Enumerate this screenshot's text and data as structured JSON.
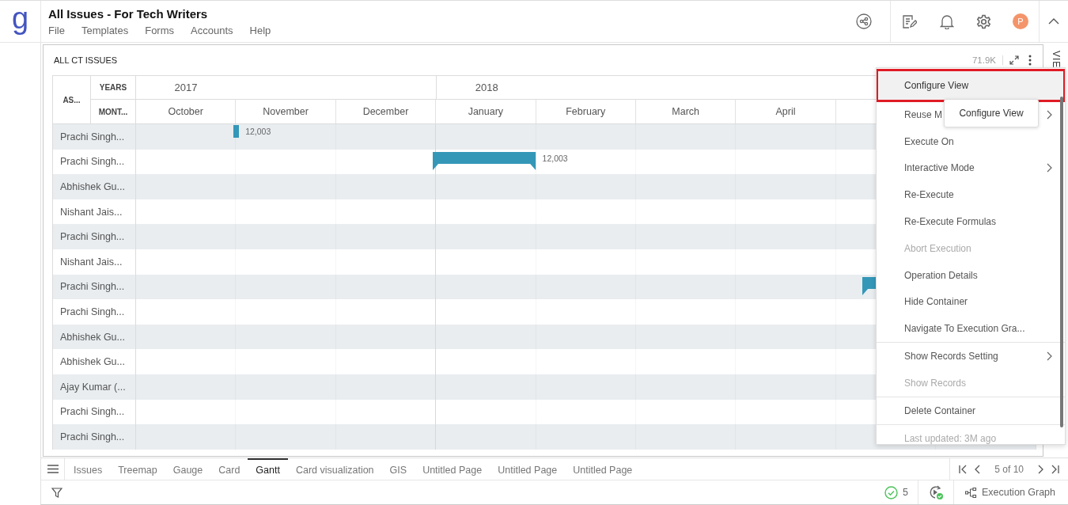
{
  "logo": "g",
  "header": {
    "title": "All Issues - For Tech Writers",
    "menu": [
      "File",
      "Templates",
      "Forms",
      "Accounts",
      "Help"
    ],
    "avatar": "P"
  },
  "side_strip": {
    "label": "VIE"
  },
  "panel": {
    "title": "ALL CT ISSUES",
    "count": "71.9K"
  },
  "gantt": {
    "corner": "AS...",
    "years_label": "YEARS",
    "months_label": "MONT...",
    "years": [
      {
        "label": "2017",
        "months": [
          "October",
          "November",
          "December"
        ]
      },
      {
        "label": "2018",
        "months": [
          "January",
          "February",
          "March",
          "April"
        ]
      }
    ],
    "rows": [
      {
        "name": "Prachi Singh...",
        "bar_label": "12,003"
      },
      {
        "name": "Prachi Singh...",
        "bar_label": "12,003"
      },
      {
        "name": "Abhishek Gu..."
      },
      {
        "name": "Nishant Jais..."
      },
      {
        "name": "Prachi Singh..."
      },
      {
        "name": "Nishant Jais..."
      },
      {
        "name": "Prachi Singh..."
      },
      {
        "name": "Prachi Singh..."
      },
      {
        "name": "Abhishek Gu..."
      },
      {
        "name": "Abhishek Gu..."
      },
      {
        "name": "Ajay Kumar (..."
      },
      {
        "name": "Prachi Singh..."
      },
      {
        "name": "Prachi Singh..."
      }
    ]
  },
  "menu": {
    "groups": [
      [
        {
          "label": "Configure View",
          "selected": true,
          "outlined": true,
          "disabled": false,
          "submenu": false
        },
        {
          "label": "Reuse M",
          "selected": false,
          "outlined": false,
          "disabled": false,
          "submenu": true
        },
        {
          "label": "Execute On",
          "selected": false,
          "outlined": false,
          "disabled": false,
          "submenu": false
        },
        {
          "label": "Interactive Mode",
          "selected": false,
          "outlined": false,
          "disabled": false,
          "submenu": true
        },
        {
          "label": "Re-Execute",
          "selected": false,
          "outlined": false,
          "disabled": false,
          "submenu": false
        },
        {
          "label": "Re-Execute Formulas",
          "selected": false,
          "outlined": false,
          "disabled": false,
          "submenu": false
        },
        {
          "label": "Abort Execution",
          "selected": false,
          "outlined": false,
          "disabled": true,
          "submenu": false
        },
        {
          "label": "Operation Details",
          "selected": false,
          "outlined": false,
          "disabled": false,
          "submenu": false
        },
        {
          "label": "Hide Container",
          "selected": false,
          "outlined": false,
          "disabled": false,
          "submenu": false
        },
        {
          "label": "Navigate To Execution Gra...",
          "selected": false,
          "outlined": false,
          "disabled": false,
          "submenu": false
        }
      ],
      [
        {
          "label": "Show Records Setting",
          "selected": false,
          "outlined": false,
          "disabled": false,
          "submenu": true
        },
        {
          "label": "Show Records",
          "selected": false,
          "outlined": false,
          "disabled": true,
          "submenu": false
        }
      ],
      [
        {
          "label": "Delete Container",
          "selected": false,
          "outlined": false,
          "disabled": false,
          "submenu": false
        }
      ]
    ],
    "footer": "Last updated: 3M ago"
  },
  "tooltip": "Configure View",
  "tabs": [
    {
      "label": "Issues",
      "selected": false
    },
    {
      "label": "Treemap",
      "selected": false
    },
    {
      "label": "Gauge",
      "selected": false
    },
    {
      "label": "Card",
      "selected": false
    },
    {
      "label": "Gantt",
      "selected": true
    },
    {
      "label": "Card visualization",
      "selected": false
    },
    {
      "label": "GIS",
      "selected": false
    },
    {
      "label": "Untitled Page",
      "selected": false
    },
    {
      "label": "Untitled Page",
      "selected": false
    },
    {
      "label": "Untitled Page",
      "selected": false
    }
  ],
  "pager": {
    "text": "5 of 10"
  },
  "status_bar": {
    "success_count": "5",
    "graph_button": "Execution Graph"
  }
}
